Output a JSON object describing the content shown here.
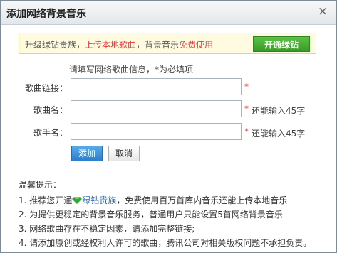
{
  "dialog": {
    "title": "添加网络背景音乐",
    "close_glyph": "×"
  },
  "promo": {
    "prefix": "升级绿钻贵族，",
    "highlight1": "上传本地歌曲",
    "middle": "，背景音乐",
    "highlight2": "免费使用",
    "button": "开通绿钻"
  },
  "form": {
    "hint": "请填写网络歌曲信息，*为必填项",
    "link_label": "歌曲链接：",
    "name_label": "歌曲名：",
    "singer_label": "歌手名：",
    "required_mark": "*",
    "name_remaining": "还能输入45字",
    "singer_remaining": "还能输入45字",
    "link_value": "",
    "name_value": "",
    "singer_value": ""
  },
  "buttons": {
    "add": "添加",
    "cancel": "取消"
  },
  "tips": {
    "title": "温馨提示：",
    "line1_prefix": "1. 推荐您开通",
    "line1_link": "绿钻贵族",
    "line1_suffix": "，免费使用百万首库内音乐还能上传本地音乐",
    "line2": "2. 为提供更稳定的背景音乐服务，普通用户只能设置5首网络背景音乐",
    "line3": "3. 网络歌曲存在不稳定因素，请添加完整链接;",
    "line4": "4. 请添加原创或经权利人许可的歌曲，腾讯公司对相关版权问题不承担负责。"
  },
  "colors": {
    "accent_red": "#e4393c",
    "brand_green": "#3a9a27",
    "primary_blue": "#2c7fce"
  },
  "icons": {
    "close": "close-icon",
    "gem": "green-diamond-icon"
  }
}
